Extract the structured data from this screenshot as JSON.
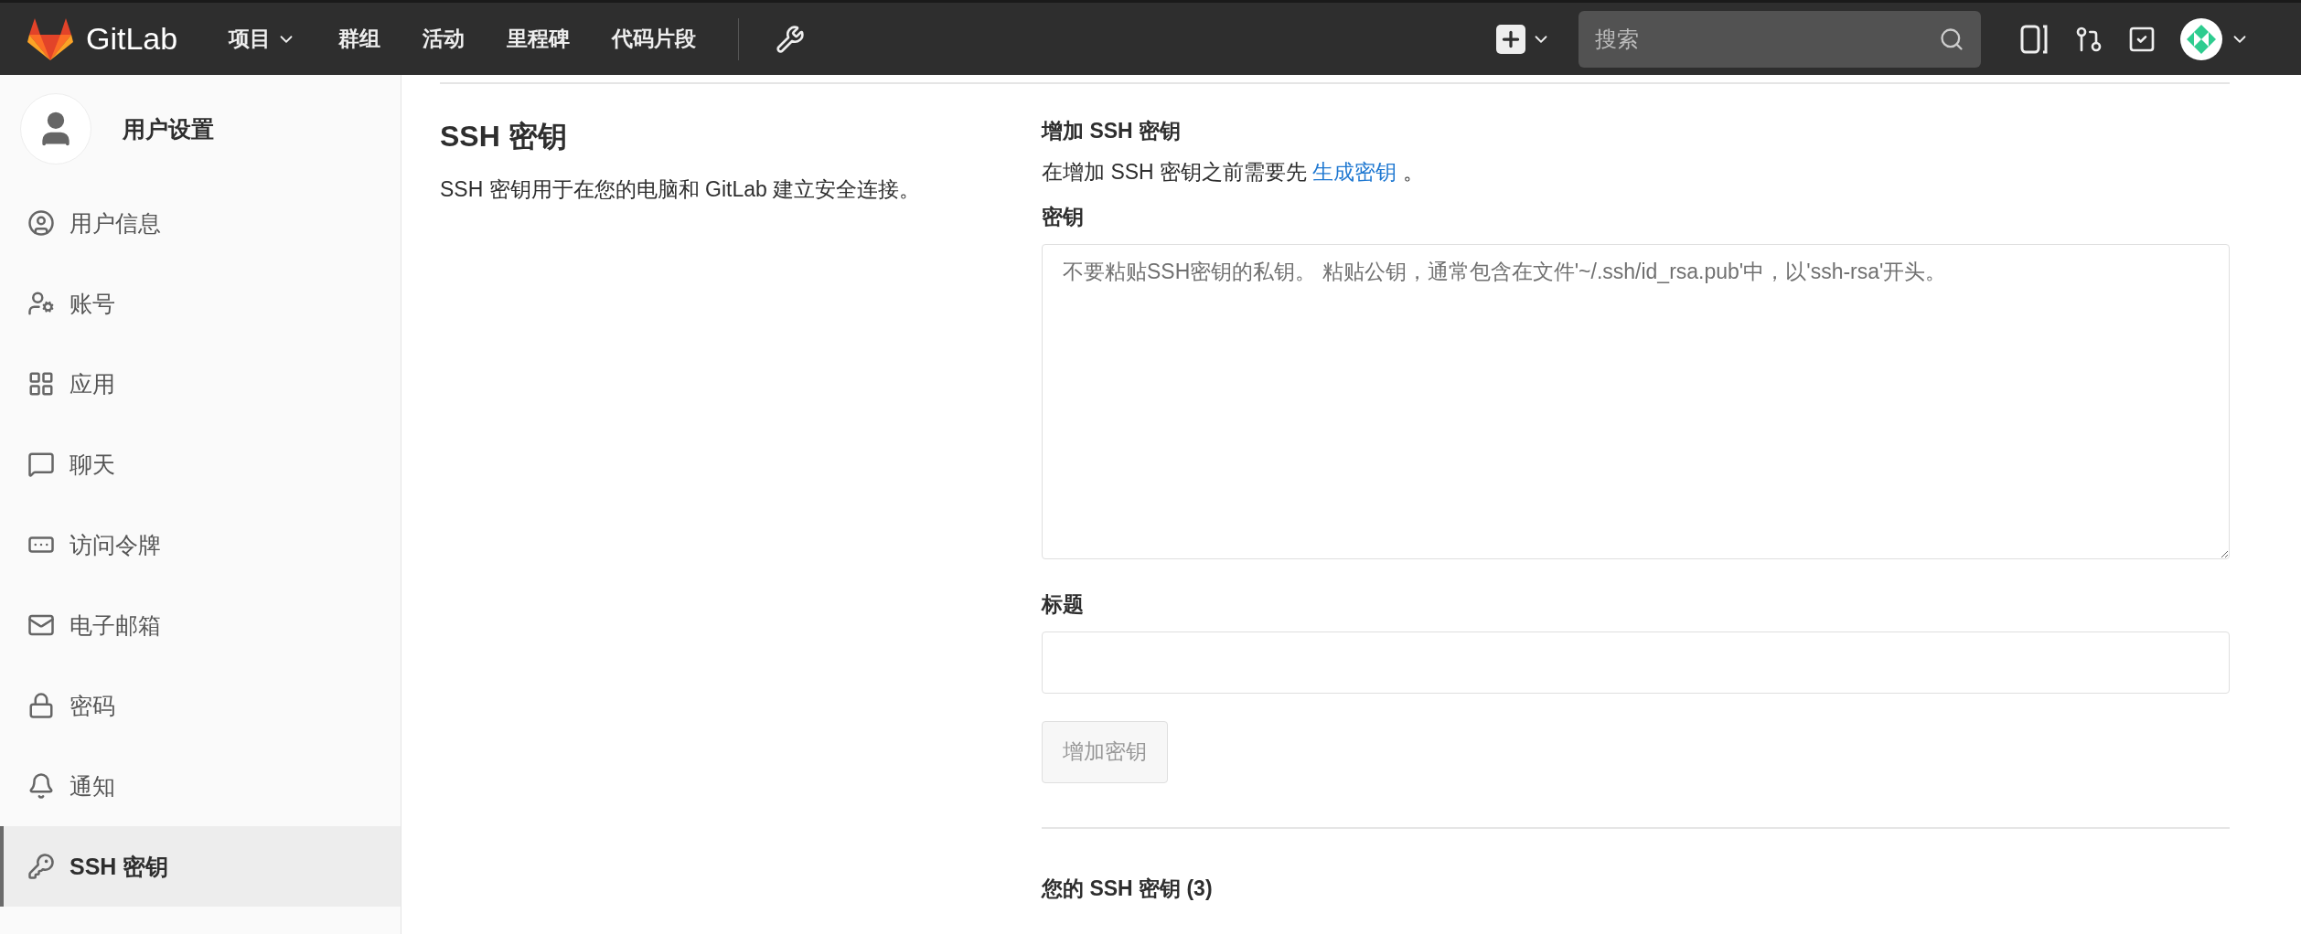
{
  "navbar": {
    "brand": "GitLab",
    "links": [
      {
        "label": "项目",
        "dropdown": true
      },
      {
        "label": "群组",
        "dropdown": false
      },
      {
        "label": "活动",
        "dropdown": false
      },
      {
        "label": "里程碑",
        "dropdown": false
      },
      {
        "label": "代码片段",
        "dropdown": false
      }
    ],
    "search": {
      "placeholder": "搜索"
    }
  },
  "sidebar": {
    "title": "用户设置",
    "items": [
      {
        "label": "用户信息",
        "kind": "profile",
        "selected": false
      },
      {
        "label": "账号",
        "kind": "account",
        "selected": false
      },
      {
        "label": "应用",
        "kind": "apps",
        "selected": false
      },
      {
        "label": "聊天",
        "kind": "chat",
        "selected": false
      },
      {
        "label": "访问令牌",
        "kind": "token",
        "selected": false
      },
      {
        "label": "电子邮箱",
        "kind": "email",
        "selected": false
      },
      {
        "label": "密码",
        "kind": "password",
        "selected": false
      },
      {
        "label": "通知",
        "kind": "notify",
        "selected": false
      },
      {
        "label": "SSH 密钥",
        "kind": "key",
        "selected": true
      }
    ]
  },
  "section": {
    "title": "SSH 密钥",
    "description": "SSH 密钥用于在您的电脑和 GitLab 建立安全连接。"
  },
  "form": {
    "title": "增加 SSH 密钥",
    "intro": "在增加 SSH 密钥之前需要先",
    "intro_link": "生成密钥",
    "intro_end": "。",
    "key_label": "密钥",
    "key_placeholder": "不要粘贴SSH密钥的私钥。 粘贴公钥，通常包含在文件'~/.ssh/id_rsa.pub'中，以'ssh-rsa'开头。",
    "title_label": "标题",
    "submit": {
      "label": "增加密钥",
      "disabled": true
    }
  },
  "keys_heading": "您的 SSH 密钥 (3)"
}
